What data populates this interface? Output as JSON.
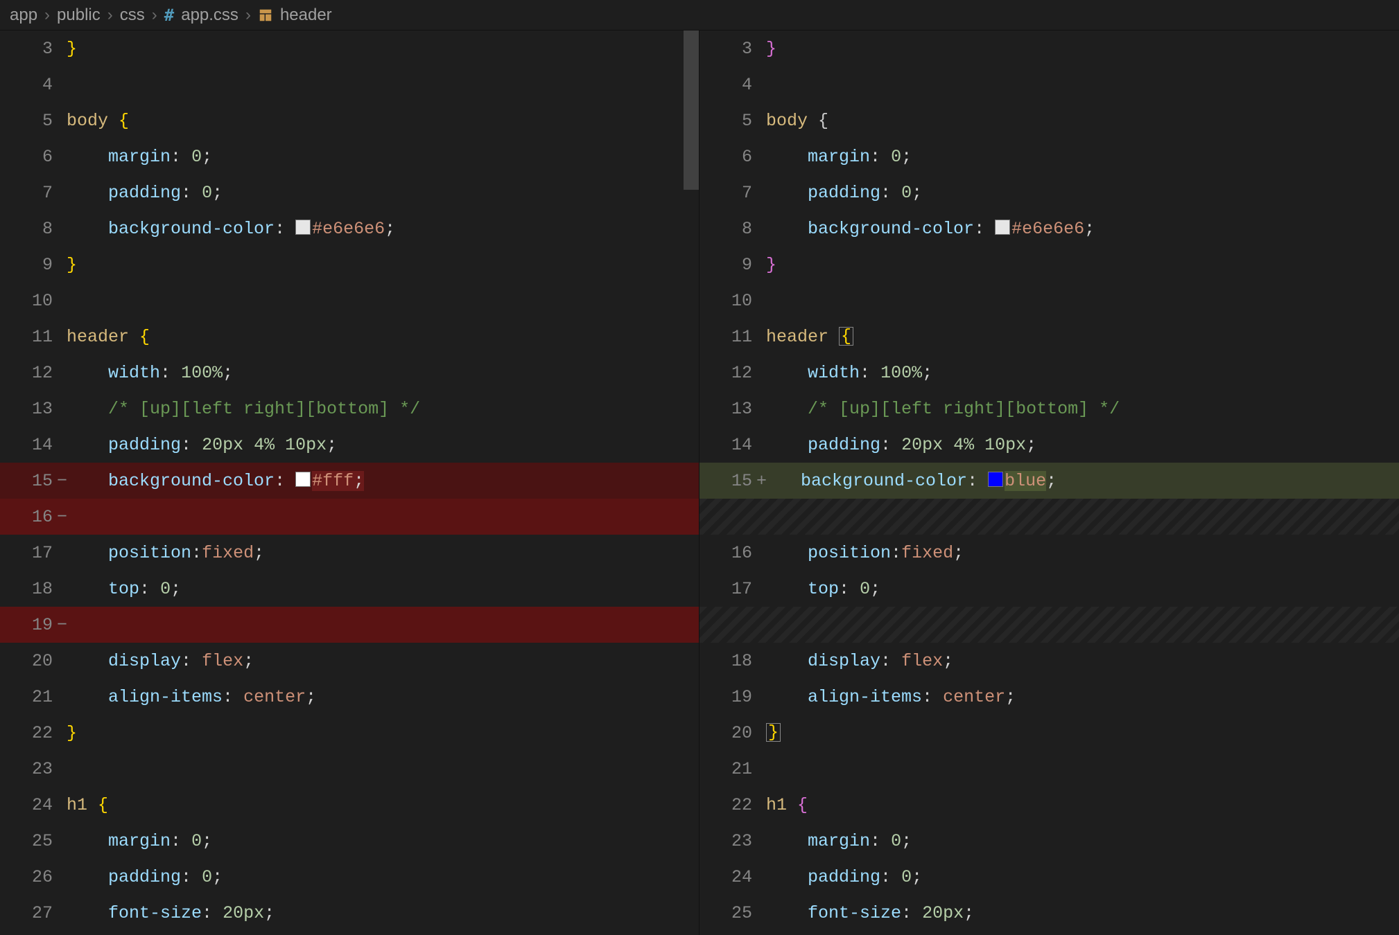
{
  "breadcrumb": {
    "segments": [
      "app",
      "public",
      "css",
      "app.css",
      "header"
    ]
  },
  "diff": {
    "left": {
      "lines": [
        {
          "num": "3",
          "code_html": "<span class='by'>}</span>"
        },
        {
          "num": "4",
          "code_html": ""
        },
        {
          "num": "5",
          "code_html": "<span class='sel'>body</span> <span class='by'>{</span>"
        },
        {
          "num": "6",
          "code_html": "<span class='indent-guide'>    </span><span class='pr'>margin</span><span class='pn'>:</span> <span class='nu'>0</span><span class='pn'>;</span>",
          "indent": true
        },
        {
          "num": "7",
          "code_html": "<span class='indent-guide'>    </span><span class='pr'>padding</span><span class='pn'>:</span> <span class='nu'>0</span><span class='pn'>;</span>",
          "indent": true
        },
        {
          "num": "8",
          "code_html": "<span class='indent-guide'>    </span><span class='pr'>background-color</span><span class='pn'>:</span> <span class='sw' style='background:#e6e6e6'></span><span class='va'>#e6e6e6</span><span class='pn'>;</span>",
          "indent": true
        },
        {
          "num": "9",
          "code_html": "<span class='by'>}</span>"
        },
        {
          "num": "10",
          "code_html": ""
        },
        {
          "num": "11",
          "code_html": "<span class='sel'>header</span> <span class='by'>{</span>"
        },
        {
          "num": "12",
          "code_html": "<span class='indent-guide'>    </span><span class='pr'>width</span><span class='pn'>:</span> <span class='nu'>100%</span><span class='pn'>;</span>",
          "indent": true
        },
        {
          "num": "13",
          "code_html": "<span class='indent-guide'>    </span><span class='cm'>/* [up][left right][bottom] */</span>",
          "indent": true
        },
        {
          "num": "14",
          "code_html": "<span class='indent-guide'>    </span><span class='pr'>padding</span><span class='pn'>:</span> <span class='nu'>20px</span> <span class='nu'>4%</span> <span class='nu'>10px</span><span class='pn'>;</span>",
          "indent": true
        },
        {
          "num": "15",
          "marker": "−",
          "kind": "deleted",
          "code_html": "<span class='indent-guide'>    </span><span class='pr'>background-color</span><span class='pn'>:</span> <span class='sw' style='background:#fff'></span><span class='word-del'><span class='va'>#fff</span><span class='pn'>;</span></span>",
          "indent": true
        },
        {
          "num": "16",
          "marker": "−",
          "kind": "deleted strong",
          "code_html": "",
          "indent": true
        },
        {
          "num": "17",
          "code_html": "<span class='indent-guide'>    </span><span class='pr'>position</span><span class='pn'>:</span><span class='va'>fixed</span><span class='pn'>;</span>",
          "indent": true
        },
        {
          "num": "18",
          "code_html": "<span class='indent-guide'>    </span><span class='pr'>top</span><span class='pn'>:</span> <span class='nu'>0</span><span class='pn'>;</span>",
          "indent": true
        },
        {
          "num": "19",
          "marker": "−",
          "kind": "deleted strong",
          "code_html": "",
          "indent": true
        },
        {
          "num": "20",
          "code_html": "<span class='indent-guide'>    </span><span class='pr'>display</span><span class='pn'>:</span> <span class='va'>flex</span><span class='pn'>;</span>",
          "indent": true
        },
        {
          "num": "21",
          "code_html": "<span class='indent-guide'>    </span><span class='pr'>align-items</span><span class='pn'>:</span> <span class='va'>center</span><span class='pn'>;</span>",
          "indent": true
        },
        {
          "num": "22",
          "code_html": "<span class='by'>}</span>"
        },
        {
          "num": "23",
          "code_html": ""
        },
        {
          "num": "24",
          "code_html": "<span class='sel'>h1</span> <span class='by'>{</span>"
        },
        {
          "num": "25",
          "code_html": "<span class='indent-guide'>    </span><span class='pr'>margin</span><span class='pn'>:</span> <span class='nu'>0</span><span class='pn'>;</span>",
          "indent": true
        },
        {
          "num": "26",
          "code_html": "<span class='indent-guide'>    </span><span class='pr'>padding</span><span class='pn'>:</span> <span class='nu'>0</span><span class='pn'>;</span>",
          "indent": true
        },
        {
          "num": "27",
          "code_html": "<span class='indent-guide'>    </span><span class='pr'>font-size</span><span class='pn'>:</span> <span class='nu'>20px</span><span class='pn'>;</span>",
          "indent": true
        }
      ]
    },
    "right": {
      "lines": [
        {
          "num": "3",
          "code_html": "<span class='bm'>}</span>"
        },
        {
          "num": "4",
          "code_html": ""
        },
        {
          "num": "5",
          "code_html": "<span class='sel'>body</span> <span class='bm></span><span class='bm'>{</span>"
        },
        {
          "num": "6",
          "code_html": "<span class='indent-guide'>    </span><span class='pr'>margin</span><span class='pn'>:</span> <span class='nu'>0</span><span class='pn'>;</span>",
          "indent": true
        },
        {
          "num": "7",
          "code_html": "<span class='indent-guide'>    </span><span class='pr'>padding</span><span class='pn'>:</span> <span class='nu'>0</span><span class='pn'>;</span>",
          "indent": true
        },
        {
          "num": "8",
          "code_html": "<span class='indent-guide'>    </span><span class='pr'>background-color</span><span class='pn'>:</span> <span class='sw' style='background:#e6e6e6'></span><span class='va'>#e6e6e6</span><span class='pn'>;</span>",
          "indent": true
        },
        {
          "num": "9",
          "code_html": "<span class='bm'>}</span>"
        },
        {
          "num": "10",
          "code_html": ""
        },
        {
          "num": "11",
          "code_html": "<span class='sel'>header</span> <span class='box'><span class='by'>{</span></span>"
        },
        {
          "num": "12",
          "code_html": "<span class='indent-guide'>    </span><span class='pr'>width</span><span class='pn'>:</span> <span class='nu'>100%</span><span class='pn'>;</span>",
          "indent": true
        },
        {
          "num": "13",
          "code_html": "<span class='indent-guide'>    </span><span class='cm'>/* [up][left right][bottom] */</span>",
          "indent": true
        },
        {
          "num": "14",
          "code_html": "<span class='indent-guide'>    </span><span class='pr'>padding</span><span class='pn'>:</span> <span class='nu'>20px</span> <span class='nu'>4%</span> <span class='nu'>10px</span><span class='pn'>;</span>",
          "indent": true
        },
        {
          "num": "15",
          "marker": "+",
          "kind": "added",
          "code_html": "<span class='marker-bar'></span><span class='indent-guide'>   </span><span class='pr'>background-color</span><span class='pn'>:</span> <span class='sw' style='background:#0000ff'></span><span class='word-add'><span class='va'>blue</span></span><span class='pn'>;</span>",
          "indent": true
        },
        {
          "kind": "shade",
          "code_html": ""
        },
        {
          "num": "16",
          "code_html": "<span class='indent-guide'>    </span><span class='pr'>position</span><span class='pn'>:</span><span class='va'>fixed</span><span class='pn'>;</span>",
          "indent": true
        },
        {
          "num": "17",
          "code_html": "<span class='indent-guide'>    </span><span class='pr'>top</span><span class='pn'>:</span> <span class='nu'>0</span><span class='pn'>;</span>",
          "indent": true
        },
        {
          "kind": "shade",
          "code_html": ""
        },
        {
          "num": "18",
          "code_html": "<span class='indent-guide'>    </span><span class='pr'>display</span><span class='pn'>:</span> <span class='va'>flex</span><span class='pn'>;</span>",
          "indent": true
        },
        {
          "num": "19",
          "code_html": "<span class='indent-guide'>    </span><span class='pr'>align-items</span><span class='pn'>:</span> <span class='va'>center</span><span class='pn'>;</span>",
          "indent": true
        },
        {
          "num": "20",
          "code_html": "<span class='box'><span class='by'>}</span></span>"
        },
        {
          "num": "21",
          "code_html": ""
        },
        {
          "num": "22",
          "code_html": "<span class='sel'>h1</span> <span class='bm'>{</span>"
        },
        {
          "num": "23",
          "code_html": "<span class='indent-guide'>    </span><span class='pr'>margin</span><span class='pn'>:</span> <span class='nu'>0</span><span class='pn'>;</span>",
          "indent": true
        },
        {
          "num": "24",
          "code_html": "<span class='indent-guide'>    </span><span class='pr'>padding</span><span class='pn'>:</span> <span class='nu'>0</span><span class='pn'>;</span>",
          "indent": true
        },
        {
          "num": "25",
          "code_html": "<span class='indent-guide'>    </span><span class='pr'>font-size</span><span class='pn'>:</span> <span class='nu'>20px</span><span class='pn'>;</span>",
          "indent": true
        }
      ]
    }
  }
}
